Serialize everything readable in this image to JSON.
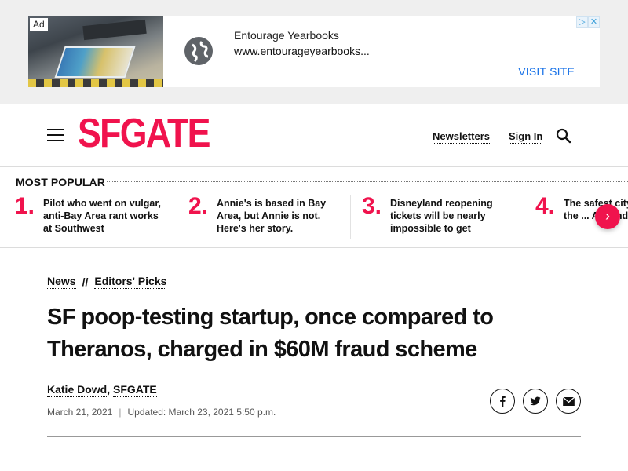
{
  "ad": {
    "badge": "Ad",
    "title": "Entourage Yearbooks",
    "url": "www.entourageyearbooks...",
    "cta": "VISIT SITE",
    "choices_icon": "ad-choices-icon",
    "close_icon": "close-icon",
    "globe_icon": "globe-icon"
  },
  "header": {
    "logo": "SFGATE",
    "newsletters": "Newsletters",
    "sign_in": "Sign In",
    "menu_icon": "hamburger-menu-icon",
    "search_icon": "search-icon"
  },
  "popular": {
    "heading": "MOST POPULAR",
    "items": [
      {
        "num": "1.",
        "text": "Pilot who went on vulgar, anti-Bay Area rant works at Southwest"
      },
      {
        "num": "2.",
        "text": "Annie's is based in Bay Area, but Annie is not. Here's her story."
      },
      {
        "num": "3.",
        "text": "Disneyland reopening tickets will be nearly impossible to get"
      },
      {
        "num": "4.",
        "text": "The safest city is in the ... Am finds"
      }
    ],
    "next_icon": "chevron-right-icon"
  },
  "article": {
    "breadcrumbs": [
      "News",
      "Editors' Picks"
    ],
    "breadcrumb_sep": "//",
    "headline": "SF poop-testing startup, once compared to Theranos, charged in $60M fraud scheme",
    "author": "Katie Dowd",
    "outlet": "SFGATE",
    "published": "March 21, 2021",
    "updated": "Updated: March 23, 2021 5:50 p.m.",
    "share_icons": [
      "facebook-icon",
      "twitter-icon",
      "email-icon"
    ]
  },
  "colors": {
    "brand": "#f0134d",
    "ad_link": "#1a73e8",
    "ad_band": "#efefef"
  }
}
